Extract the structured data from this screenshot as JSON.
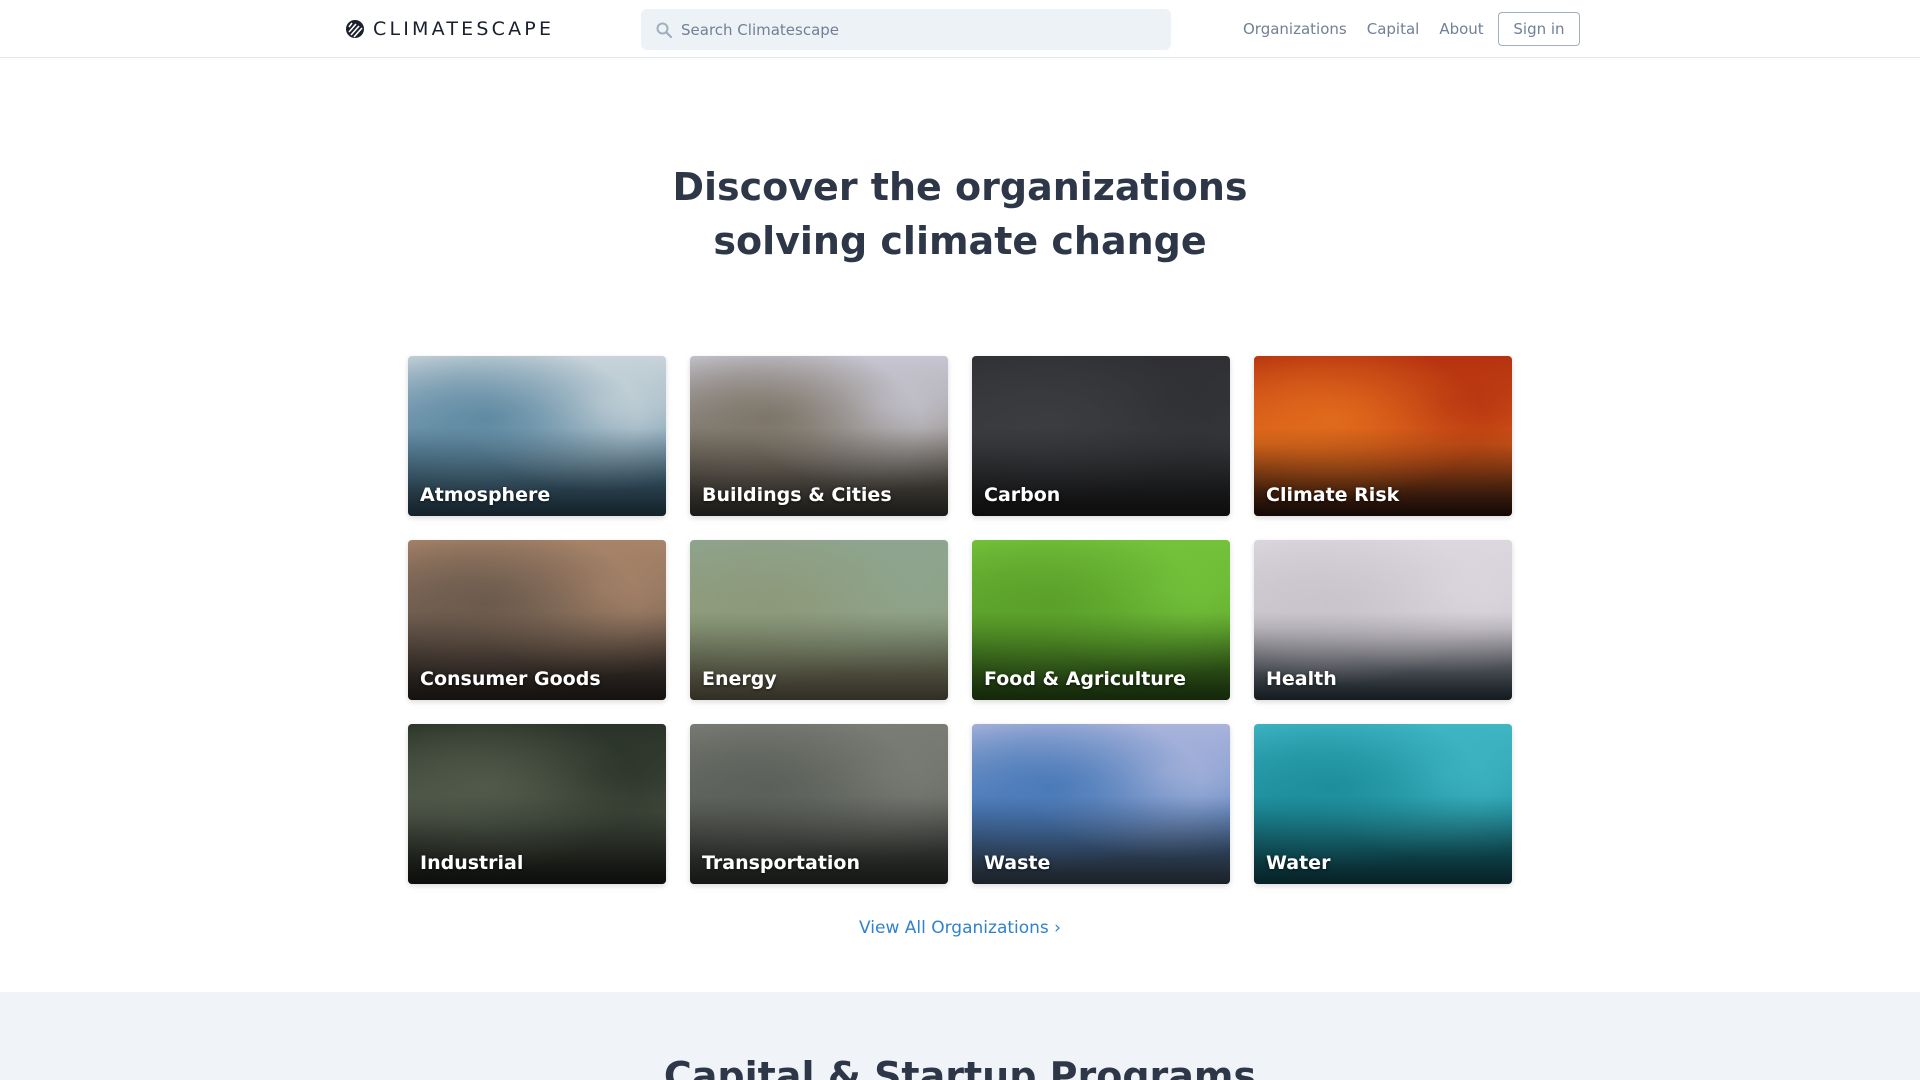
{
  "header": {
    "brand": "CLIMATESCAPE",
    "search_placeholder": "Search Climatescape",
    "nav": [
      "Organizations",
      "Capital",
      "About"
    ],
    "signin": "Sign in"
  },
  "hero": {
    "line1": "Discover the organizations",
    "line2": "solving climate change"
  },
  "categories": [
    {
      "label": "Atmosphere",
      "icon": "atmosphere",
      "colors": [
        "#c9d4da",
        "#5f8aa3",
        "#2c4a5c"
      ]
    },
    {
      "label": "Buildings & Cities",
      "icon": "buildings",
      "colors": [
        "#c7c6d2",
        "#7d7568",
        "#3d3a35"
      ]
    },
    {
      "label": "Carbon",
      "icon": "carbon",
      "colors": [
        "#2f3033",
        "#3b3c40",
        "#1b1c1e"
      ]
    },
    {
      "label": "Climate Risk",
      "icon": "climate-risk",
      "colors": [
        "#b63210",
        "#e06a1c",
        "#2b1410"
      ]
    },
    {
      "label": "Consumer Goods",
      "icon": "consumer-goods",
      "colors": [
        "#a88469",
        "#6b5a4d",
        "#2c2622"
      ]
    },
    {
      "label": "Energy",
      "icon": "energy",
      "colors": [
        "#8fa58f",
        "#8d9a7a",
        "#6d6550"
      ]
    },
    {
      "label": "Food & Agriculture",
      "icon": "food",
      "colors": [
        "#74c33b",
        "#5aa02a",
        "#2c5418"
      ]
    },
    {
      "label": "Health",
      "icon": "health",
      "colors": [
        "#dcd7de",
        "#c9c4cc",
        "#2d3e48"
      ]
    },
    {
      "label": "Industrial",
      "icon": "industrial",
      "colors": [
        "#2a3328",
        "#51594a",
        "#1c1f1a"
      ]
    },
    {
      "label": "Transportation",
      "icon": "transportation",
      "colors": [
        "#7a7d76",
        "#5c605a",
        "#2f322f"
      ]
    },
    {
      "label": "Waste",
      "icon": "waste",
      "colors": [
        "#a9b4dc",
        "#4a7ab8",
        "#3c4a58"
      ]
    },
    {
      "label": "Water",
      "icon": "water",
      "colors": [
        "#3fb6c4",
        "#1d8e9c",
        "#0f4a55"
      ]
    }
  ],
  "view_all": "View All Organizations ›",
  "section2": {
    "title": "Capital & Startup Programs"
  }
}
